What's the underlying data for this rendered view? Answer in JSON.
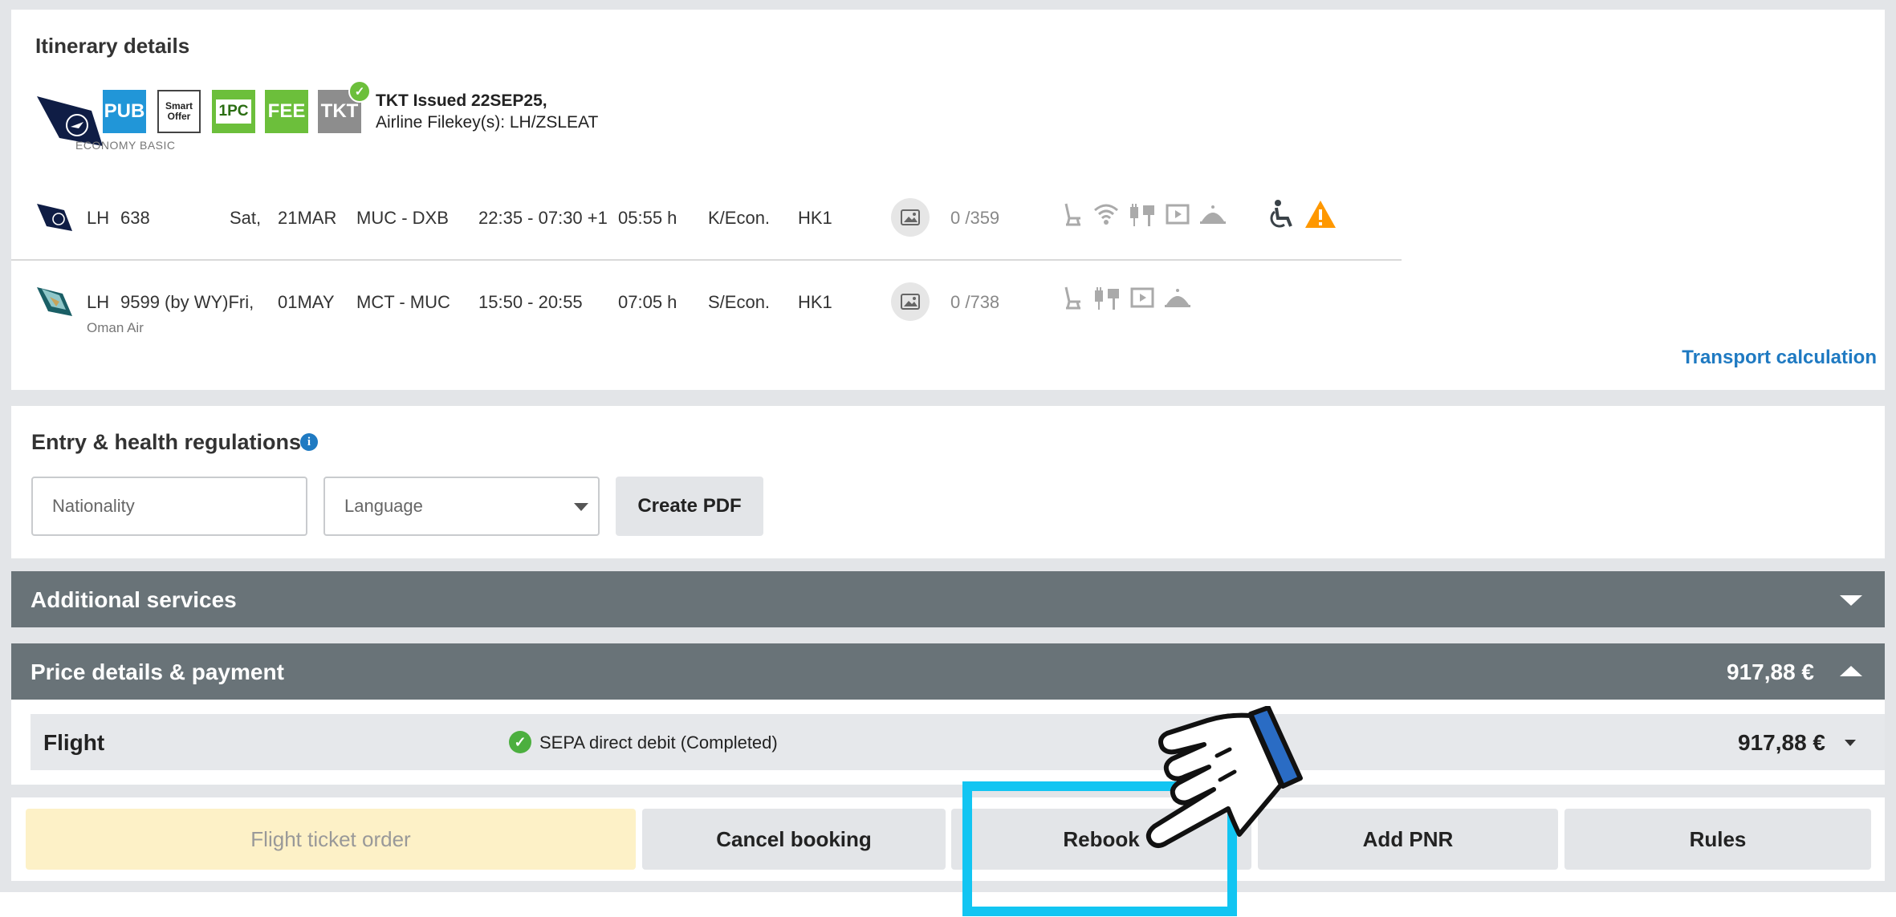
{
  "itinerary": {
    "title": "Itinerary details",
    "badges": {
      "pub": "PUB",
      "smart_line1": "Smart",
      "smart_line2": "Offer",
      "baggage": "1PC",
      "fee": "FEE",
      "tkt": "TKT"
    },
    "fare_class": "ECONOMY BASIC",
    "ticket_status": "TKT Issued  22SEP25,",
    "filekey": "Airline Filekey(s): LH/ZSLEAT",
    "segments": [
      {
        "airline_code": "LH",
        "flight": "638",
        "day": "Sat,",
        "date": "21MAR",
        "route": "MUC - DXB",
        "times": "22:35 - 07:30 +1",
        "duration": "05:55 h",
        "class": "K/Econ.",
        "status": "HK1",
        "seats": "0 /359",
        "carrier_name": ""
      },
      {
        "airline_code": "LH",
        "flight": "9599 (by WY)Fri,",
        "day": "",
        "date": "01MAY",
        "route": "MCT - MUC",
        "times": "15:50 - 20:55",
        "duration": "07:05 h",
        "class": "S/Econ.",
        "status": "HK1",
        "seats": "0 /738",
        "carrier_name": "Oman Air"
      }
    ],
    "transport_link": "Transport calculation"
  },
  "entry": {
    "title": "Entry & health regulations",
    "nationality_placeholder": "Nationality",
    "language_placeholder": "Language",
    "create_pdf": "Create PDF"
  },
  "additional_services": {
    "title": "Additional services"
  },
  "price": {
    "title": "Price details & payment",
    "total": "917,88 €",
    "flight_label": "Flight",
    "payment_status": "SEPA direct debit (Completed)",
    "flight_amount": "917,88 €"
  },
  "actions": {
    "ticket_order": "Flight ticket order",
    "cancel": "Cancel booking",
    "rebook": "Rebook",
    "add_pnr": "Add PNR",
    "rules": "Rules"
  },
  "colors": {
    "bar": "#697378",
    "link": "#1f7ac2",
    "highlight": "#12c5f2",
    "warning": "#ff9800",
    "success": "#4caf3f",
    "primary_action_bg": "#fdf1c7"
  }
}
